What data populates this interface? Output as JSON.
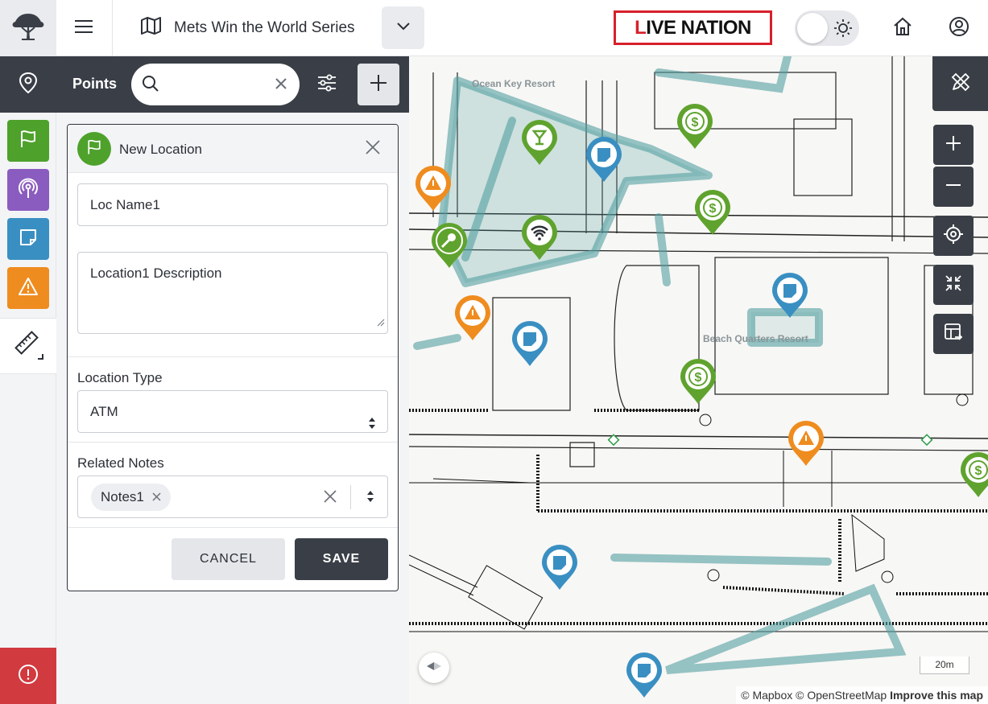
{
  "header": {
    "map_title": "Mets Win the World Series",
    "brand_logo_text": "LIVE NATION",
    "icons": [
      "tree-logo-icon",
      "hamburger-icon",
      "map-icon",
      "chevron-down-icon",
      "sun-icon",
      "home-icon",
      "user-icon"
    ]
  },
  "rail": {
    "tools": [
      "pin-icon",
      "flag-icon",
      "broadcast-icon",
      "note-icon",
      "warning-icon",
      "ruler-icon",
      "alert-icon"
    ],
    "colors": {
      "flag": "#4ea22c",
      "broadcast": "#8b5cbf",
      "note": "#3a8fc2",
      "warning": "#ef8c1f",
      "alert": "#d13a3f"
    }
  },
  "panel": {
    "title": "Points",
    "search_value": "",
    "form": {
      "title": "New Location",
      "name_value": "Loc Name1",
      "description_value": "Location1 Description",
      "location_type_label": "Location Type",
      "location_type_value": "ATM",
      "related_notes_label": "Related Notes",
      "related_notes_chips": [
        "Notes1"
      ],
      "cancel_label": "CANCEL",
      "save_label": "SAVE"
    }
  },
  "map": {
    "labels": [
      "Ocean Key Resort",
      "Beach Quarters Resort"
    ],
    "scale_label": "20m",
    "attribution_prefix": "© Mapbox © OpenStreetMap",
    "attribution_link": "Improve this map",
    "pin_colors": {
      "green": "#5fa32e",
      "orange": "#ef8c1f",
      "blue": "#3a8fc2"
    }
  }
}
